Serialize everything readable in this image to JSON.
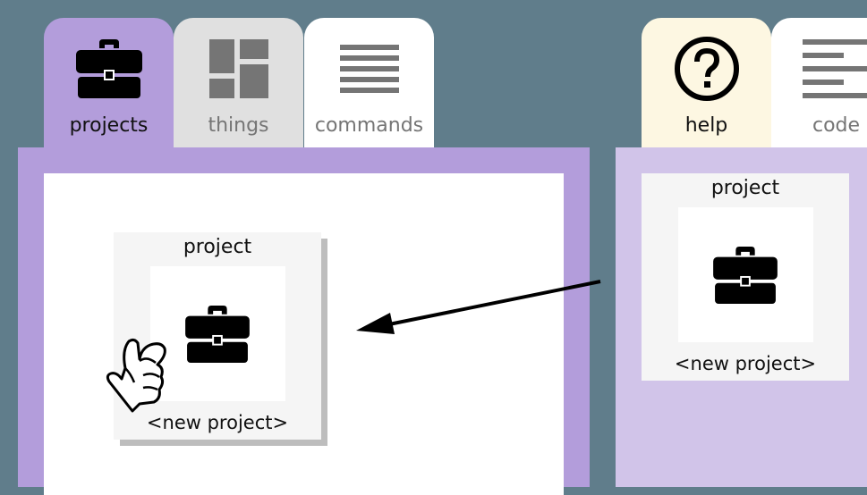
{
  "tabs": {
    "projects": {
      "label": "projects",
      "icon": "briefcase-icon"
    },
    "things": {
      "label": "things",
      "icon": "dashboard-icon"
    },
    "commands": {
      "label": "commands",
      "icon": "lines-icon"
    },
    "help": {
      "label": "help",
      "icon": "help-circle-icon"
    },
    "code": {
      "label": "code",
      "icon": "code-lines-icon"
    }
  },
  "dragged_card": {
    "title": "project",
    "name": "<new project>",
    "icon": "briefcase-icon"
  },
  "source_card": {
    "title": "project",
    "name": "<new project>",
    "icon": "briefcase-icon"
  },
  "colors": {
    "background": "#607d8b",
    "projects_tab": "#b39ddb",
    "things_tab": "#e0e0e0",
    "help_tab": "#fdf7e2",
    "right_panel": "#d1c4e9"
  }
}
